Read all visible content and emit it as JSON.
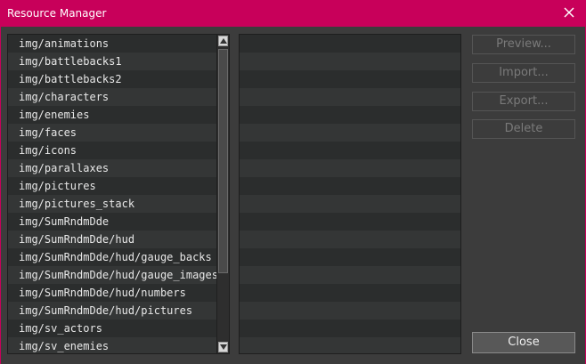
{
  "window": {
    "title": "Resource Manager"
  },
  "folders": [
    "img/animations",
    "img/battlebacks1",
    "img/battlebacks2",
    "img/characters",
    "img/enemies",
    "img/faces",
    "img/icons",
    "img/parallaxes",
    "img/pictures",
    "img/pictures_stack",
    "img/SumRndmDde",
    "img/SumRndmDde/hud",
    "img/SumRndmDde/hud/gauge_backs",
    "img/SumRndmDde/hud/gauge_images",
    "img/SumRndmDde/hud/numbers",
    "img/SumRndmDde/hud/pictures",
    "img/sv_actors",
    "img/sv_enemies"
  ],
  "buttons": {
    "preview": "Preview...",
    "import": "Import...",
    "export": "Export...",
    "delete": "Delete",
    "close": "Close"
  },
  "colors": {
    "titlebar": "#c8005a",
    "window_bg": "#3c3c3c"
  }
}
